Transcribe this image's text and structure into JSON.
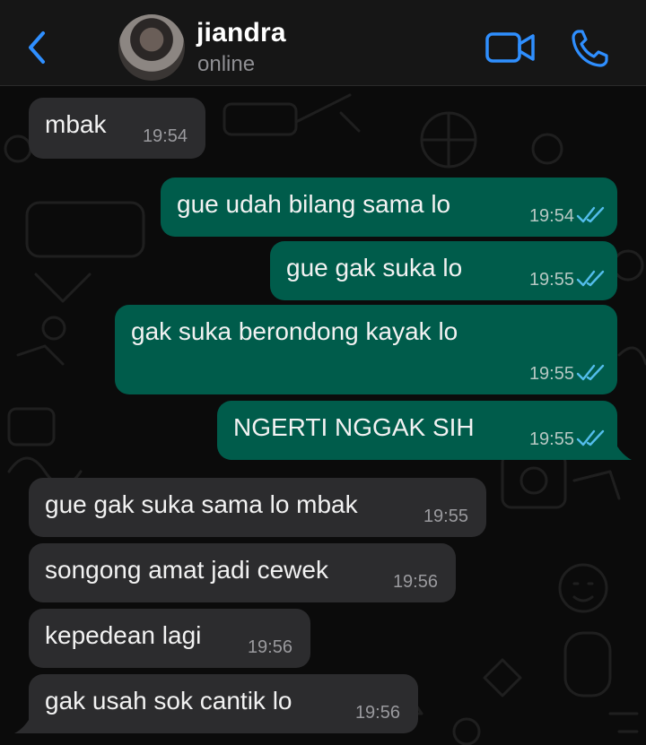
{
  "contact": {
    "name": "jiandra",
    "status": "online"
  },
  "icons": {
    "back": "chevron-left-icon",
    "video": "video-camera-icon",
    "call": "phone-icon",
    "read": "double-check-icon"
  },
  "colors": {
    "accent": "#2f8fff",
    "incoming_bubble": "#2c2c2e",
    "outgoing_bubble": "#005c4b",
    "read_ticks": "#53bdeb"
  },
  "messages": [
    {
      "direction": "in",
      "text": "mbak",
      "time": "19:54"
    },
    {
      "direction": "out",
      "text": "gue udah bilang sama lo",
      "time": "19:54",
      "read": true
    },
    {
      "direction": "out",
      "text": "gue gak suka lo",
      "time": "19:55",
      "read": true
    },
    {
      "direction": "out",
      "text": "gak suka berondong kayak lo",
      "time": "19:55",
      "read": true
    },
    {
      "direction": "out",
      "text": "NGERTI NGGAK SIH",
      "time": "19:55",
      "read": true
    },
    {
      "direction": "in",
      "text": "gue gak suka sama lo mbak",
      "time": "19:55"
    },
    {
      "direction": "in",
      "text": "songong amat jadi cewek",
      "time": "19:56"
    },
    {
      "direction": "in",
      "text": "kepedean lagi",
      "time": "19:56"
    },
    {
      "direction": "in",
      "text": "gak usah sok cantik lo",
      "time": "19:56"
    }
  ]
}
